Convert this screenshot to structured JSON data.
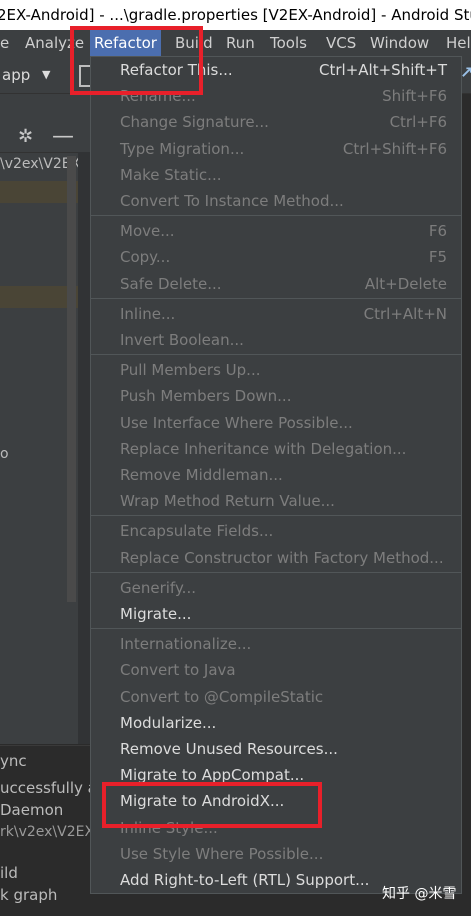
{
  "window": {
    "title": "2EX-Android] - ...\\gradle.properties [V2EX-Android] - Android Stu"
  },
  "menubar": {
    "items": [
      {
        "label": "e"
      },
      {
        "label": "Analyze"
      },
      {
        "label": "Refactor"
      },
      {
        "label": "Build"
      },
      {
        "label": "Run"
      },
      {
        "label": "Tools"
      },
      {
        "label": "VCS"
      },
      {
        "label": "Window"
      },
      {
        "label": "Hel"
      }
    ]
  },
  "toolbar": {
    "run_config": "app"
  },
  "project_panel": {
    "path": "\\v2ex\\V2EX",
    "fragment": "o"
  },
  "build_panel": {
    "lines": [
      "ync",
      "uccessfully at",
      "Daemon",
      "rk\\v2ex\\V2EX",
      "ild",
      "k graph"
    ]
  },
  "refactor_menu": {
    "groups": [
      [
        {
          "label": "Refactor This...",
          "shortcut": "Ctrl+Alt+Shift+T",
          "enabled": true
        },
        {
          "label": "Rename...",
          "shortcut": "Shift+F6",
          "enabled": false
        },
        {
          "label": "Change Signature...",
          "shortcut": "Ctrl+F6",
          "enabled": false
        },
        {
          "label": "Type Migration...",
          "shortcut": "Ctrl+Shift+F6",
          "enabled": false
        },
        {
          "label": "Make Static...",
          "shortcut": "",
          "enabled": false
        },
        {
          "label": "Convert To Instance Method...",
          "shortcut": "",
          "enabled": false
        }
      ],
      [
        {
          "label": "Move...",
          "shortcut": "F6",
          "enabled": false
        },
        {
          "label": "Copy...",
          "shortcut": "F5",
          "enabled": false
        },
        {
          "label": "Safe Delete...",
          "shortcut": "Alt+Delete",
          "enabled": false
        }
      ],
      [
        {
          "label": "Inline...",
          "shortcut": "Ctrl+Alt+N",
          "enabled": false
        },
        {
          "label": "Invert Boolean...",
          "shortcut": "",
          "enabled": false
        }
      ],
      [
        {
          "label": "Pull Members Up...",
          "shortcut": "",
          "enabled": false
        },
        {
          "label": "Push Members Down...",
          "shortcut": "",
          "enabled": false
        },
        {
          "label": "Use Interface Where Possible...",
          "shortcut": "",
          "enabled": false
        },
        {
          "label": "Replace Inheritance with Delegation...",
          "shortcut": "",
          "enabled": false
        },
        {
          "label": "Remove Middleman...",
          "shortcut": "",
          "enabled": false
        },
        {
          "label": "Wrap Method Return Value...",
          "shortcut": "",
          "enabled": false
        }
      ],
      [
        {
          "label": "Encapsulate Fields...",
          "shortcut": "",
          "enabled": false
        },
        {
          "label": "Replace Constructor with Factory Method...",
          "shortcut": "",
          "enabled": false
        }
      ],
      [
        {
          "label": "Generify...",
          "shortcut": "",
          "enabled": false
        },
        {
          "label": "Migrate...",
          "shortcut": "",
          "enabled": true
        }
      ],
      [
        {
          "label": "Internationalize...",
          "shortcut": "",
          "enabled": false
        },
        {
          "label": "Convert to Java",
          "shortcut": "",
          "enabled": false
        },
        {
          "label": "Convert to @CompileStatic",
          "shortcut": "",
          "enabled": false
        },
        {
          "label": "Modularize...",
          "shortcut": "",
          "enabled": true
        },
        {
          "label": "Remove Unused Resources...",
          "shortcut": "",
          "enabled": true
        },
        {
          "label": "Migrate to AppCompat...",
          "shortcut": "",
          "enabled": true
        },
        {
          "label": "Migrate to AndroidX...",
          "shortcut": "",
          "enabled": true
        },
        {
          "label": "Inline Style...",
          "shortcut": "",
          "enabled": false
        },
        {
          "label": "Use Style Where Possible...",
          "shortcut": "",
          "enabled": false
        },
        {
          "label": "Add Right-to-Left (RTL) Support...",
          "shortcut": "",
          "enabled": true
        }
      ]
    ]
  },
  "watermark": {
    "text": "知乎 @米雪"
  },
  "colors": {
    "menu_bg": "#3c3f41",
    "selected_menu": "#4b6eaf",
    "annotation": "#e8202a",
    "disabled_text": "#7d7d7d",
    "enabled_text": "#dcdcdc"
  }
}
